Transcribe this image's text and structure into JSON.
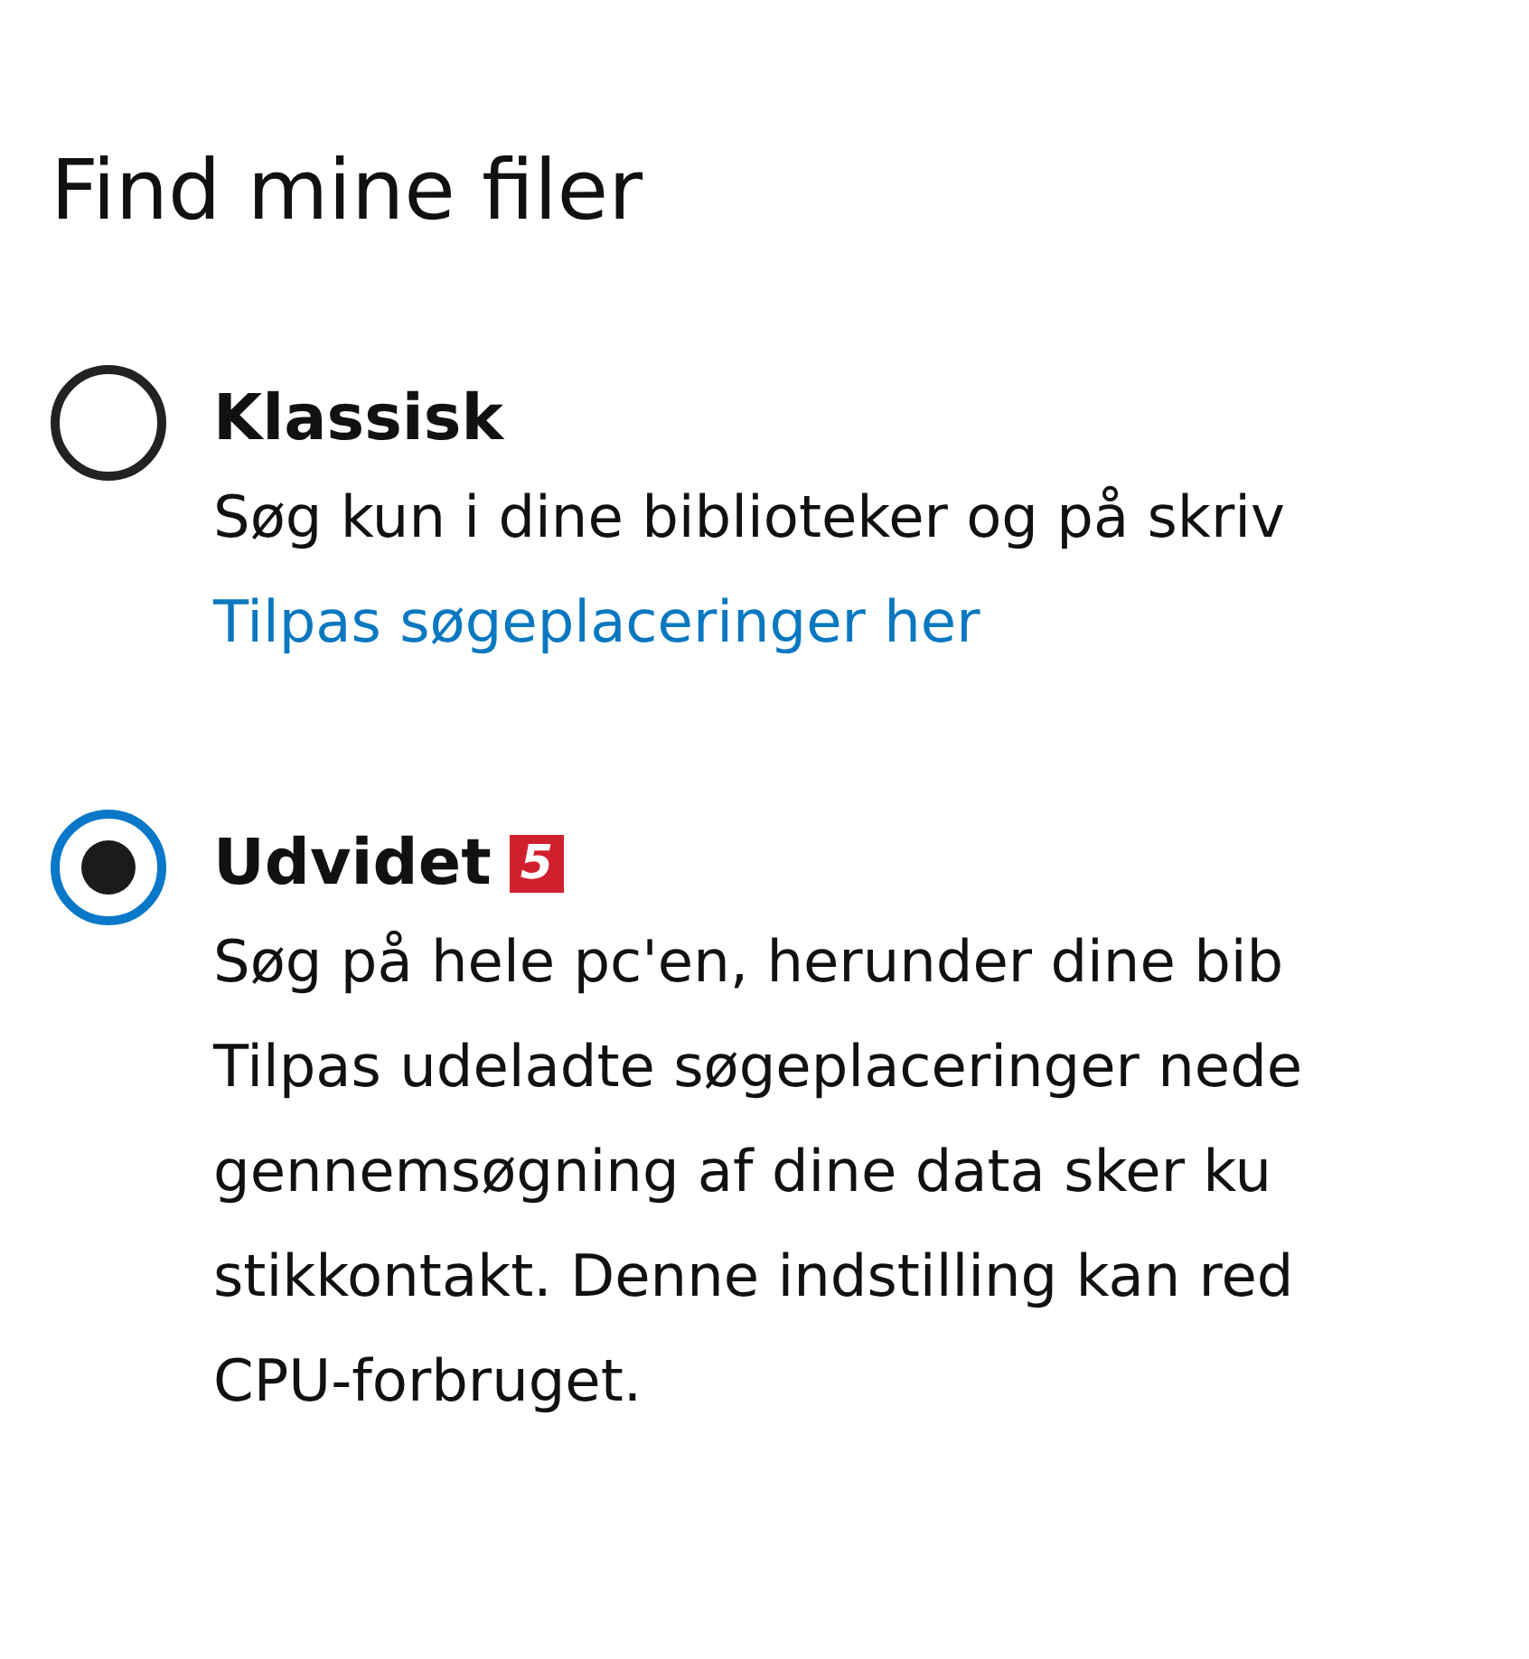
{
  "title": "Find mine filer",
  "options": [
    {
      "label": "Klassisk",
      "selected": false,
      "lines": [
        "Søg kun i dine biblioteker og på skriv"
      ],
      "link": "Tilpas søgeplaceringer her"
    },
    {
      "label": "Udvidet",
      "selected": true,
      "badge": "5",
      "lines": [
        "Søg på hele pc'en, herunder dine bib",
        "Tilpas udeladte søgeplaceringer nede",
        "gennemsøgning af dine data sker ku",
        "stikkontakt. Denne indstilling kan red",
        "CPU-forbruget."
      ]
    }
  ]
}
